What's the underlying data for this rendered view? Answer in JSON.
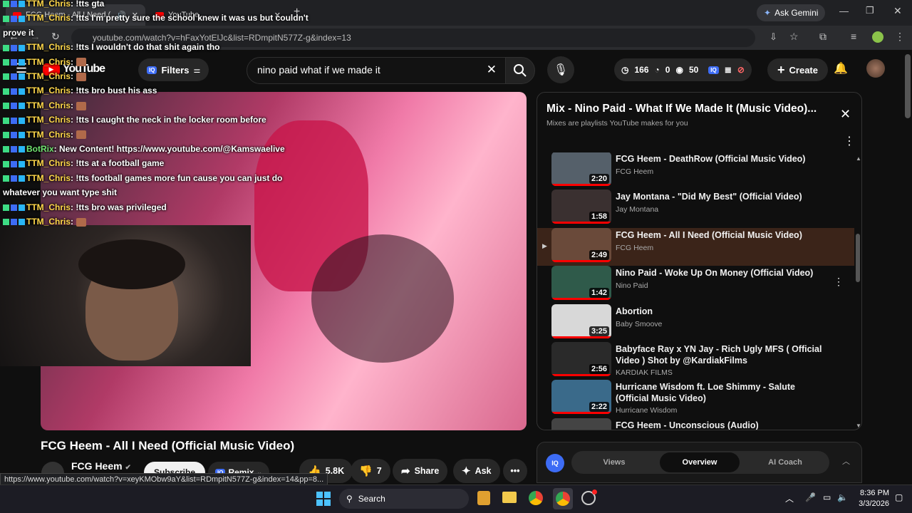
{
  "browser": {
    "tabs": [
      {
        "label": "FCG Heem - All I Need (Offi"
      },
      {
        "label": "YouTube"
      }
    ],
    "gemini_label": "Ask Gemini",
    "url": "youtube.com/watch?v=hFaxYotElJc&list=RDmpitN577Z-g&index=13",
    "status_url": "https://www.youtube.com/watch?v=xeyKMObw9aY&list=RDmpitN577Z-g&index=14&pp=8..."
  },
  "header": {
    "logo_text": "YouTube",
    "filters_label": "Filters",
    "search_value": "nino paid what if we made it",
    "stats": {
      "views": "166",
      "likes": "0",
      "watchers": "50"
    },
    "create_label": "Create"
  },
  "chat": [
    {
      "user": "TTM_Chris",
      "text": ": !tts gta"
    },
    {
      "user": "TTM_Chris",
      "text": ": !tts I'm pretty sure the school knew it was us but couldn't"
    },
    {
      "user": "",
      "text": "prove it"
    },
    {
      "user": "TTM_Chris",
      "text": ": !tts I wouldn't do that shit again tho"
    },
    {
      "user": "TTM_Chris",
      "text": ":"
    },
    {
      "user": "TTM_Chris",
      "text": ":"
    },
    {
      "user": "TTM_Chris",
      "text": ": !tts bro bust his ass"
    },
    {
      "user": "TTM_Chris",
      "text": ":"
    },
    {
      "user": "TTM_Chris",
      "text": ": !tts I caught the neck in the locker room before"
    },
    {
      "user": "TTM_Chris",
      "text": ":"
    },
    {
      "user": "BotRix",
      "text": ": New Content! https://www.youtube.com/@Kamswaelive"
    },
    {
      "user": "TTM_Chris",
      "text": ": !tts at a football game"
    },
    {
      "user": "TTM_Chris",
      "text": ": !tts football games more fun cause you can just do"
    },
    {
      "user": "",
      "text": "whatever you want type shit"
    },
    {
      "user": "TTM_Chris",
      "text": ": !tts bro was privileged"
    },
    {
      "user": "TTM_Chris",
      "text": ":"
    }
  ],
  "playlist": {
    "title": "Mix - Nino Paid - What If We Made It (Music Video)...",
    "subtitle": "Mixes are playlists YouTube makes for you",
    "items": [
      {
        "title": "FCG Heem - DeathRow (Official Music Video)",
        "channel": "FCG Heem",
        "duration": "2:20",
        "progress": 1.0
      },
      {
        "title": "Jay Montana - \"Did My Best\" (Official Video)",
        "channel": "Jay Montana",
        "duration": "1:58",
        "progress": 1.0
      },
      {
        "title": "FCG Heem - All I Need (Official Music Video)",
        "channel": "FCG Heem",
        "duration": "2:49",
        "progress": 1.0
      },
      {
        "title": "Nino Paid - Woke Up On Money (Official Video)",
        "channel": "Nino Paid",
        "duration": "1:42",
        "progress": 1.0
      },
      {
        "title": "Abortion",
        "channel": "Baby Smoove",
        "duration": "3:25",
        "progress": 1.0
      },
      {
        "title": "Babyface Ray x YN Jay - Rich Ugly MFS ( Official Video ) Shot by @KardiakFilms",
        "channel": "KARDIAK FILMS",
        "duration": "2:56",
        "progress": 1.0
      },
      {
        "title": "Hurricane Wisdom ft. Loe Shimmy - Salute (Official Music Video)",
        "channel": "Hurricane Wisdom",
        "duration": "2:22",
        "progress": 1.0
      },
      {
        "title": "FCG Heem - Unconscious (Audio) #NoHardFeelings",
        "channel": "",
        "duration": "",
        "progress": 0
      }
    ]
  },
  "video": {
    "title": "FCG Heem - All I Need (Official Music Video)",
    "channel": "FCG Heem",
    "subscribe_label": "Subscribe",
    "remix_label": "Remix",
    "likes": "5.8K",
    "dislikes": "7",
    "share_label": "Share",
    "ask_label": "Ask"
  },
  "iq_panel": {
    "tabs": [
      "Views",
      "Overview",
      "AI Coach"
    ]
  },
  "taskbar": {
    "search_label": "Search",
    "time": "8:36 PM",
    "date": "3/3/2026"
  },
  "colors": {
    "accent_red": "#ff0000",
    "chat_user": "#ffd84a",
    "chat_bot": "#6fe36f",
    "iq_blue": "#3d6cf5"
  }
}
